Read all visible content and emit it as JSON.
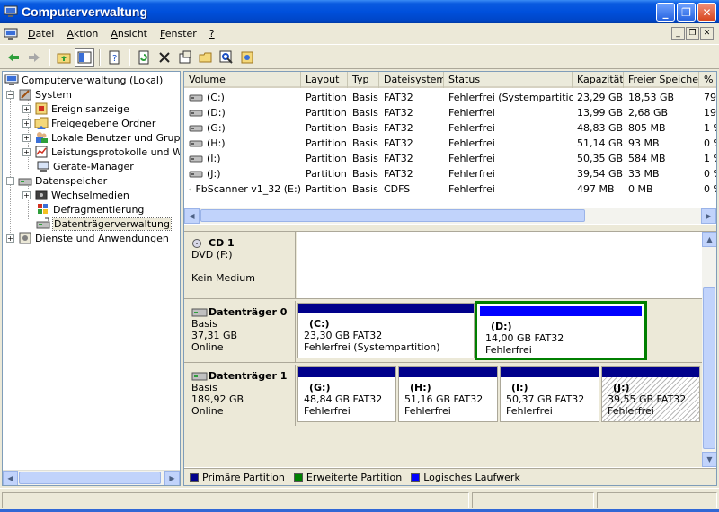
{
  "window": {
    "title": "Computerverwaltung"
  },
  "menu": {
    "items": [
      {
        "key": "D",
        "rest": "atei"
      },
      {
        "key": "A",
        "rest": "ktion"
      },
      {
        "key": "A",
        "rest": "nsicht"
      },
      {
        "key": "F",
        "rest": "enster"
      },
      {
        "key": "?",
        "rest": ""
      }
    ]
  },
  "tree": {
    "root": "Computerverwaltung (Lokal)",
    "system": "System",
    "system_children": [
      "Ereignisanzeige",
      "Freigegebene Ordner",
      "Lokale Benutzer und Gruppen",
      "Leistungsprotokolle und Warnungen",
      "Geräte-Manager"
    ],
    "storage": "Datenspeicher",
    "storage_children": [
      "Wechselmedien",
      "Defragmentierung",
      "Datenträgerverwaltung"
    ],
    "services": "Dienste und Anwendungen"
  },
  "volumes": {
    "headers": [
      "Volume",
      "Layout",
      "Typ",
      "Dateisystem",
      "Status",
      "Kapazität",
      "Freier Speicher",
      "%"
    ],
    "rows": [
      [
        "(C:)",
        "Partition",
        "Basis",
        "FAT32",
        "Fehlerfrei (Systempartition)",
        "23,29 GB",
        "18,53 GB",
        "79"
      ],
      [
        "(D:)",
        "Partition",
        "Basis",
        "FAT32",
        "Fehlerfrei",
        "13,99 GB",
        "2,68 GB",
        "19"
      ],
      [
        "(G:)",
        "Partition",
        "Basis",
        "FAT32",
        "Fehlerfrei",
        "48,83 GB",
        "805 MB",
        "1 %"
      ],
      [
        "(H:)",
        "Partition",
        "Basis",
        "FAT32",
        "Fehlerfrei",
        "51,14 GB",
        "93 MB",
        "0 %"
      ],
      [
        "(I:)",
        "Partition",
        "Basis",
        "FAT32",
        "Fehlerfrei",
        "50,35 GB",
        "584 MB",
        "1 %"
      ],
      [
        "(J:)",
        "Partition",
        "Basis",
        "FAT32",
        "Fehlerfrei",
        "39,54 GB",
        "33 MB",
        "0 %"
      ],
      [
        "FbScanner v1_32 (E:)",
        "Partition",
        "Basis",
        "CDFS",
        "Fehlerfrei",
        "497 MB",
        "0 MB",
        "0 %"
      ]
    ]
  },
  "disks": {
    "cd": {
      "name": "CD 1",
      "type": "DVD (F:)",
      "status": "Kein Medium"
    },
    "d0": {
      "name": "Datenträger 0",
      "type": "Basis",
      "size": "37,31 GB",
      "status": "Online",
      "parts": [
        {
          "name": "(C:)",
          "size": "23,30 GB FAT32",
          "status": "Fehlerfrei (Systempartition)"
        },
        {
          "name": "(D:)",
          "size": "14,00 GB FAT32",
          "status": "Fehlerfrei"
        }
      ]
    },
    "d1": {
      "name": "Datenträger 1",
      "type": "Basis",
      "size": "189,92 GB",
      "status": "Online",
      "parts": [
        {
          "name": "(G:)",
          "size": "48,84 GB FAT32",
          "status": "Fehlerfrei"
        },
        {
          "name": "(H:)",
          "size": "51,16 GB FAT32",
          "status": "Fehlerfrei"
        },
        {
          "name": "(I:)",
          "size": "50,37 GB FAT32",
          "status": "Fehlerfrei"
        },
        {
          "name": "(J:)",
          "size": "39,55 GB FAT32",
          "status": "Fehlerfrei"
        }
      ]
    }
  },
  "legend": {
    "primary": "Primäre Partition",
    "extended": "Erweiterte Partition",
    "logical": "Logisches Laufwerk"
  },
  "colors": {
    "primary": "#00008B",
    "extended": "#008000",
    "logical": "#0000FF",
    "title_bar": "#0050DC"
  }
}
